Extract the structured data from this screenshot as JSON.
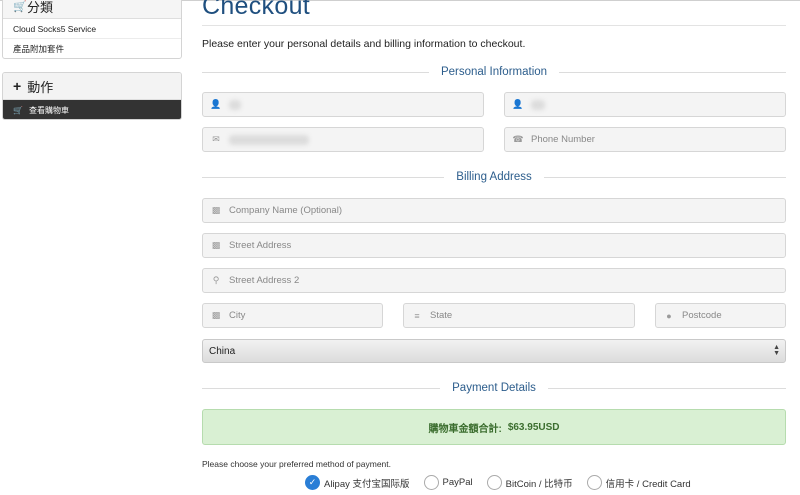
{
  "sidebar": {
    "categories": {
      "icon": "cart-icon",
      "title": "分類",
      "items": [
        {
          "label": "Cloud Socks5 Service"
        },
        {
          "label": "產品附加套件"
        }
      ]
    },
    "actions": {
      "icon": "plus-icon",
      "title": "動作",
      "items": [
        {
          "icon": "cart-icon",
          "label": "查看購物車",
          "active": true
        }
      ]
    }
  },
  "page": {
    "title": "Checkout",
    "intro": "Please enter your personal details and billing information to checkout."
  },
  "sections": {
    "personal": "Personal Information",
    "billing": "Billing Address",
    "payment": "Payment Details"
  },
  "personal": {
    "first_name": {
      "icon": "user-icon",
      "value": "",
      "redacted": true
    },
    "last_name": {
      "icon": "user-icon",
      "value": "",
      "redacted": true
    },
    "email": {
      "icon": "envelope-icon",
      "value": "",
      "redacted": true
    },
    "phone": {
      "icon": "phone-icon",
      "placeholder": "Phone Number"
    }
  },
  "billing": {
    "company": {
      "icon": "building-icon",
      "placeholder": "Company Name (Optional)"
    },
    "street": {
      "icon": "building-icon",
      "placeholder": "Street Address"
    },
    "street2": {
      "icon": "map-marker-icon",
      "placeholder": "Street Address 2"
    },
    "city": {
      "icon": "building-icon",
      "placeholder": "City"
    },
    "state": {
      "icon": "signpost-icon",
      "placeholder": "State"
    },
    "postcode": {
      "icon": "circle-icon",
      "placeholder": "Postcode"
    },
    "country": {
      "selected": "China"
    }
  },
  "payment": {
    "total_label": "購物車金額合計:",
    "total_amount": "$63.95USD",
    "choose_text": "Please choose your preferred method of payment.",
    "methods": [
      {
        "label": "Alipay 支付宝国际版",
        "checked": true
      },
      {
        "label": "PayPal",
        "checked": false
      },
      {
        "label": "BitCoin / 比特币",
        "checked": false
      },
      {
        "label": "信用卡 / Credit Card",
        "checked": false
      }
    ]
  },
  "colors": {
    "heading": "#1f4f7f",
    "section_label": "#2c5d8c",
    "total_bg": "#d9f0d3",
    "total_text": "#3c6e2f",
    "radio_checked": "#2a7ed6",
    "sidebar_active_bg": "#333333"
  }
}
